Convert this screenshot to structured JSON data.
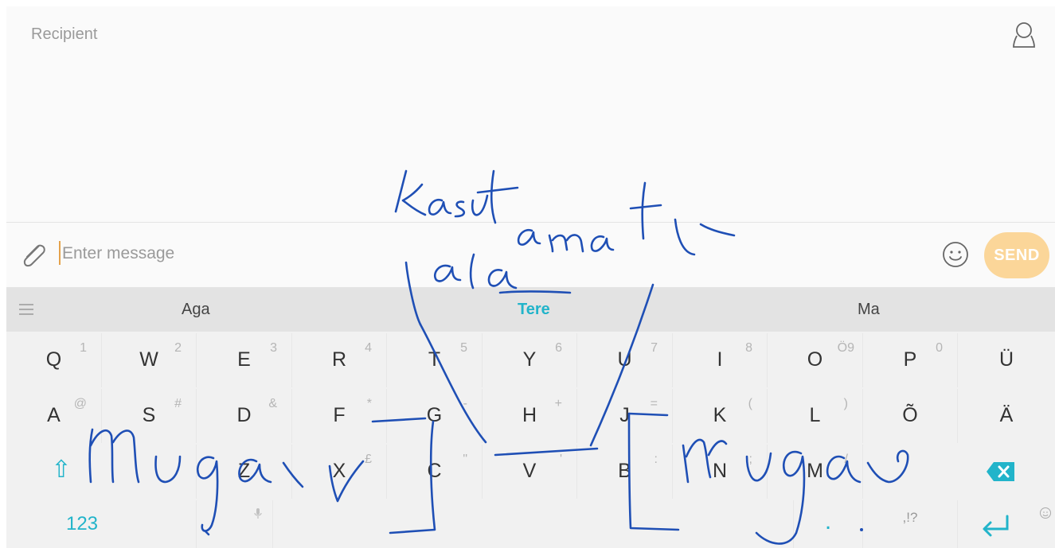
{
  "header": {
    "recipient_label": "Recipient",
    "contact_icon": "person-icon"
  },
  "compose": {
    "placeholder": "Enter message",
    "send_label": "SEND",
    "attach_icon": "paperclip-icon",
    "emoji_icon": "smiley-icon",
    "send_color": "#fbd699"
  },
  "keyboard": {
    "suggestions": [
      "Aga",
      "Tere",
      "Ma"
    ],
    "highlight_color": "#22b4ca",
    "rows": [
      [
        {
          "label": "Q",
          "sub": "1"
        },
        {
          "label": "W",
          "sub": "2"
        },
        {
          "label": "E",
          "sub": "3"
        },
        {
          "label": "R",
          "sub": "4"
        },
        {
          "label": "T",
          "sub": "5"
        },
        {
          "label": "Y",
          "sub": "6"
        },
        {
          "label": "U",
          "sub": "7"
        },
        {
          "label": "I",
          "sub": "8"
        },
        {
          "label": "O",
          "sub": "Ö9"
        },
        {
          "label": "P",
          "sub": "0"
        },
        {
          "label": "Ü",
          "sub": ""
        }
      ],
      [
        {
          "label": "A",
          "sub": "@"
        },
        {
          "label": "S",
          "sub": "#"
        },
        {
          "label": "D",
          "sub": "&"
        },
        {
          "label": "F",
          "sub": "*"
        },
        {
          "label": "G",
          "sub": "-"
        },
        {
          "label": "H",
          "sub": "+"
        },
        {
          "label": "J",
          "sub": "="
        },
        {
          "label": "K",
          "sub": "("
        },
        {
          "label": "L",
          "sub": ")"
        },
        {
          "label": "Õ",
          "sub": ""
        },
        {
          "label": "Ä",
          "sub": ""
        }
      ],
      [
        {
          "label": "⇧",
          "sub": ""
        },
        {
          "label": "Z",
          "sub": ""
        },
        {
          "label": "X",
          "sub": "£"
        },
        {
          "label": "C",
          "sub": "\""
        },
        {
          "label": "V",
          "sub": "'"
        },
        {
          "label": "B",
          "sub": ":"
        },
        {
          "label": "N",
          "sub": ";"
        },
        {
          "label": "M",
          "sub": "/"
        },
        {
          "label": "⌫",
          "sub": ""
        }
      ],
      [
        {
          "label": "123",
          "sub": ""
        },
        {
          "label": "",
          "sub": ""
        },
        {
          "label": "",
          "sub": ""
        },
        {
          "label": ".",
          "sub": ""
        },
        {
          "label": ",!?",
          "sub": ""
        },
        {
          "label": "↵",
          "sub": ""
        }
      ]
    ]
  }
}
